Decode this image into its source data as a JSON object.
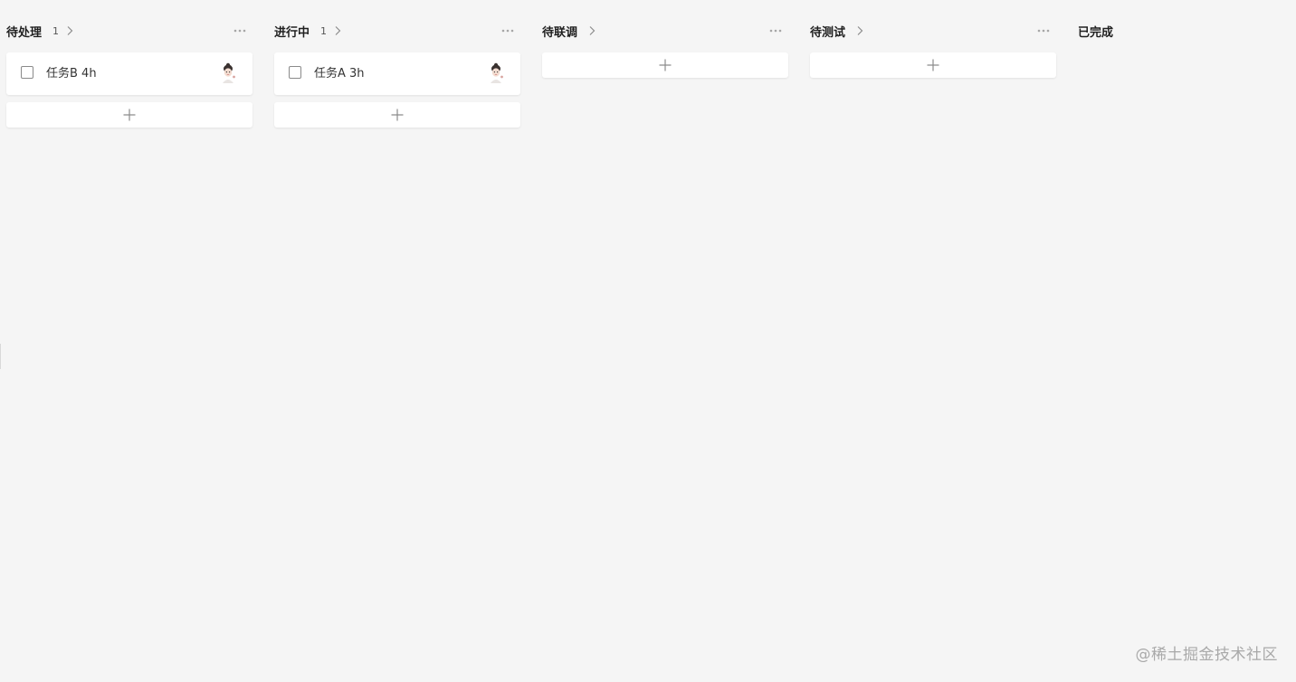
{
  "columns": [
    {
      "title": "待处理",
      "count": "1",
      "cards": [
        {
          "title": "任务B 4h"
        }
      ]
    },
    {
      "title": "进行中",
      "count": "1",
      "cards": [
        {
          "title": "任务A 3h"
        }
      ]
    },
    {
      "title": "待联调",
      "count": "",
      "cards": []
    },
    {
      "title": "待测试",
      "count": "",
      "cards": []
    },
    {
      "title": "已完成",
      "count": "",
      "cards": []
    }
  ],
  "icons": {
    "chevron": "chevron-right-icon",
    "more": "more-horizontal-icon",
    "add": "plus-icon",
    "checkbox": "checkbox-icon",
    "avatar": "avatar"
  },
  "colors": {
    "background": "#f5f5f5",
    "card": "#ffffff",
    "title_text": "#1f1f1f",
    "muted": "#999999"
  },
  "watermark": "@稀土掘金技术社区"
}
